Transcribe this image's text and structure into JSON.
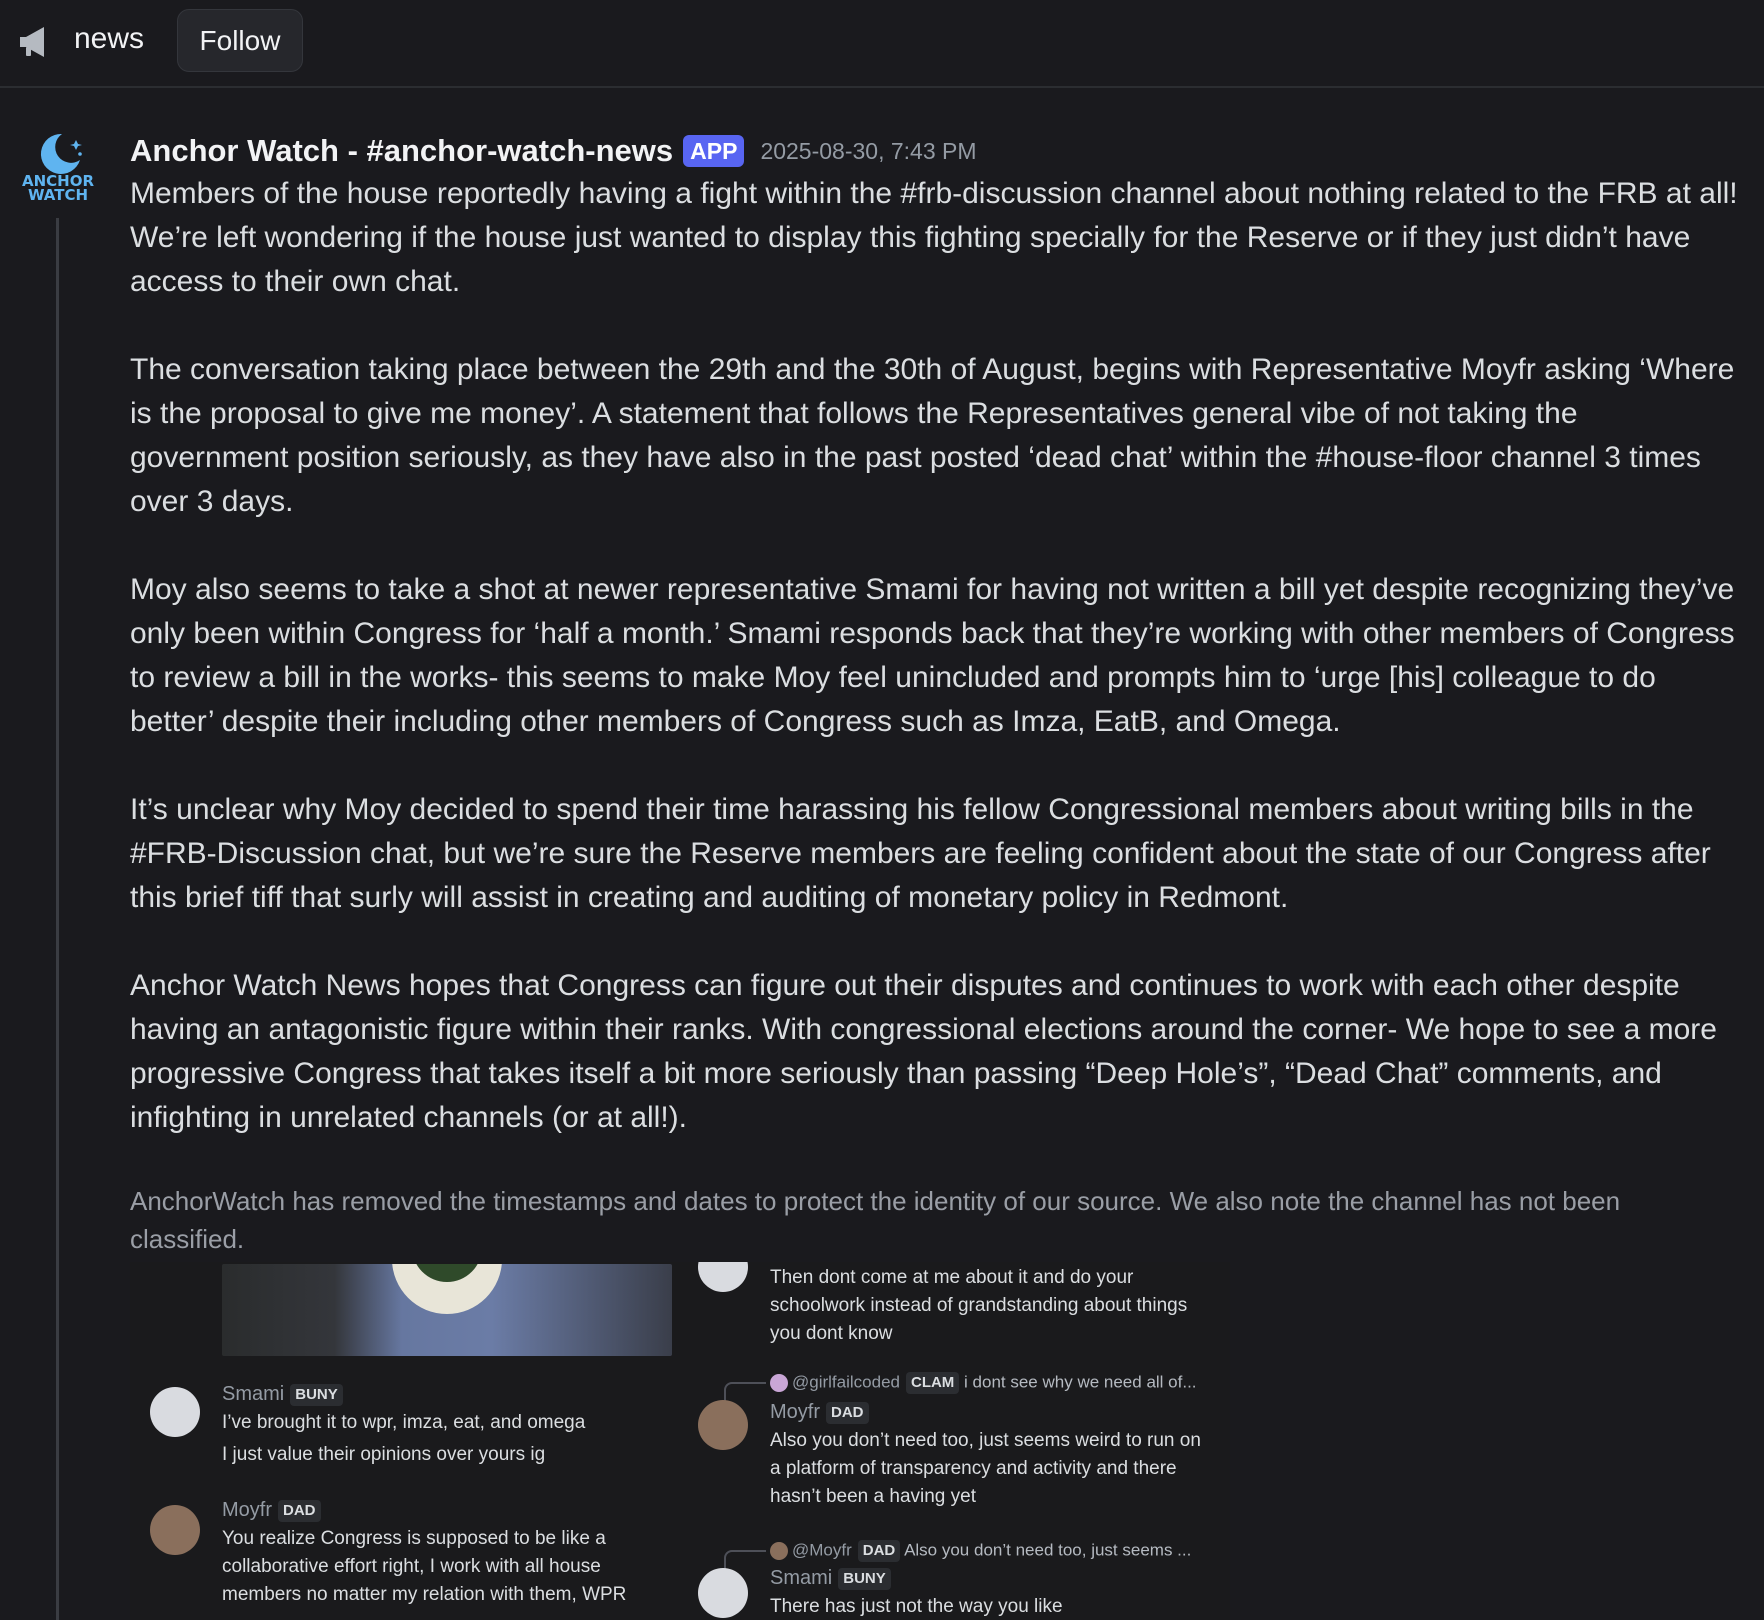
{
  "channel": {
    "name": "news",
    "follow_label": "Follow"
  },
  "message": {
    "avatar_line1": "ANCHOR",
    "avatar_line2": "WATCH",
    "author": "Anchor Watch - #anchor-watch-news",
    "badge": "APP",
    "timestamp": "2025-08-30, 7:43 PM",
    "paragraphs": [
      "Members of the house reportedly having a fight within the #frb-discussion channel about nothing related to the FRB at all! We’re left wondering if the house just wanted to display this fighting specially for the Reserve or if they just didn’t have access to their own chat.",
      "The conversation taking place between the 29th and the 30th of August, begins with Representative Moyfr asking ‘Where is the proposal to give me money’. A statement that follows the Representatives general vibe of not taking the government position seriously, as they have also in the past posted ‘dead chat’ within the #house-floor channel 3 times over 3 days.",
      "Moy also seems to take a shot at newer representative Smami for having not written a bill yet despite recognizing they’ve only been within Congress for ‘half a month.’ Smami responds back that they’re working with other members of Congress to review a bill in the works- this seems to make Moy feel unincluded and prompts him to ‘urge [his] colleague to do better’ despite their including other members of Congress such as Imza, EatB, and Omega.",
      "It’s unclear why Moy decided to spend their time harassing his fellow Congressional members about writing bills in the #FRB-Discussion chat, but we’re sure the Reserve members are feeling confident about the state of our Congress after this brief tiff that surly will assist in creating and auditing of monetary policy in Redmont.",
      "Anchor Watch News hopes that Congress can figure out their disputes and continues to work with each other despite having an antagonistic figure within their ranks. With congressional elections around the corner- We hope to see a more progressive Congress that takes itself a bit more seriously than passing “Deep Hole’s”, “Dead Chat” comments, and infighting in unrelated channels (or at all!)."
    ],
    "note": "AnchorWatch has removed the timestamps and dates to protect the identity of our source. We also note the channel has not been classified."
  },
  "screenshot": {
    "left": [
      {
        "name": "Smami",
        "role": "BUNY",
        "lines": [
          "I’ve brought it to wpr, imza, eat, and omega",
          "I just value their opinions over yours ig"
        ]
      },
      {
        "name": "Moyfr",
        "role": "DAD",
        "lines": [
          "You realize Congress is supposed to be like a",
          "collaborative effort right, I work with all house",
          "members no matter my relation with them, WPR"
        ]
      }
    ],
    "right_top": [
      "Then dont come at me about it and do your",
      "schoolwork instead of grandstanding about things",
      "you dont know"
    ],
    "reply1": {
      "mention": "@girlfailcoded",
      "role": "CLAM",
      "text": "i dont see why we need all of..."
    },
    "msg1": {
      "name": "Moyfr",
      "role": "DAD",
      "lines": [
        "Also you don’t need too, just seems weird to run on",
        "a platform of transparency and activity and there",
        "hasn’t been a having yet"
      ]
    },
    "reply2": {
      "mention": "@Moyfr",
      "role": "DAD",
      "text": "Also you don’t need too, just seems ..."
    },
    "msg2": {
      "name": "Smami",
      "role": "BUNY",
      "lines": [
        "There has just not the way you like"
      ]
    }
  }
}
